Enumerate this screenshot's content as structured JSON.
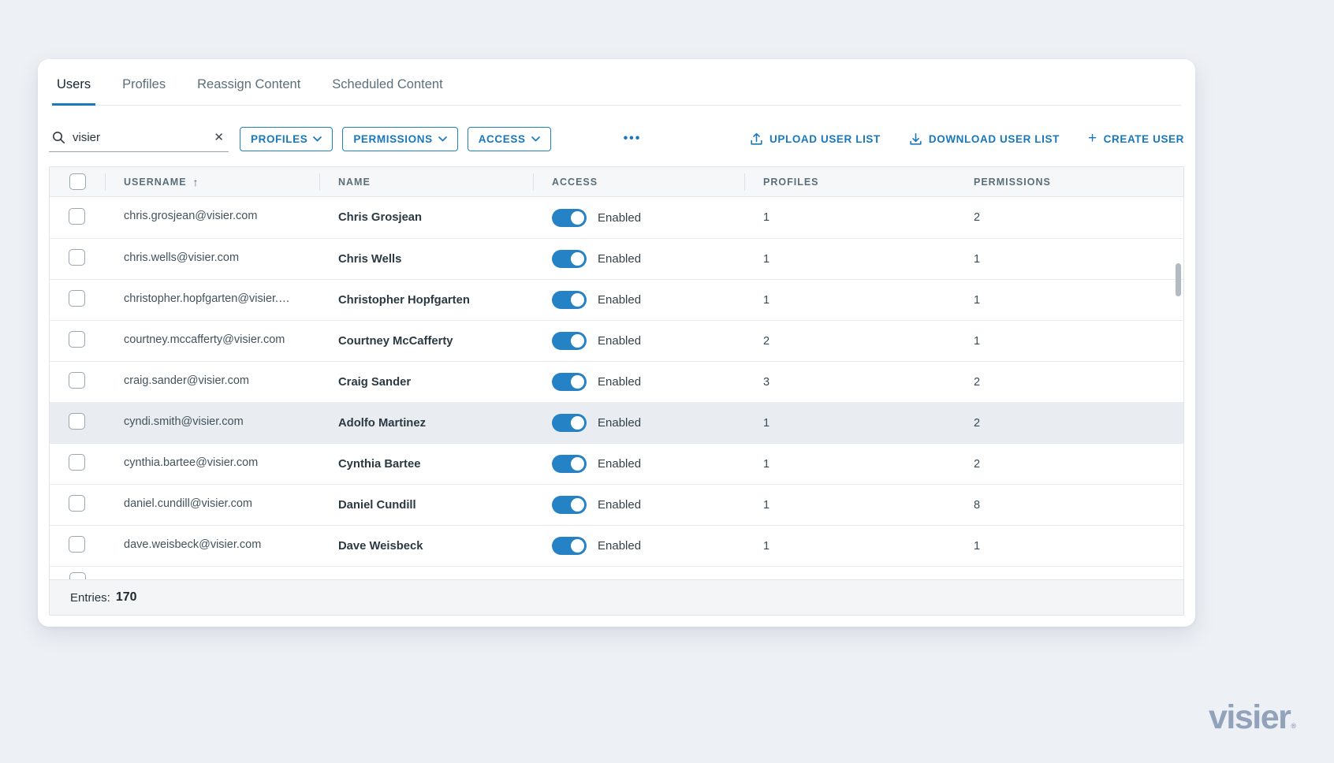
{
  "tabs": [
    {
      "label": "Users",
      "active": true
    },
    {
      "label": "Profiles",
      "active": false
    },
    {
      "label": "Reassign Content",
      "active": false
    },
    {
      "label": "Scheduled Content",
      "active": false
    }
  ],
  "toolbar": {
    "search": {
      "value": "visier",
      "placeholder": ""
    },
    "filters": [
      {
        "label": "PROFILES"
      },
      {
        "label": "PERMISSIONS"
      },
      {
        "label": "ACCESS"
      }
    ],
    "actions": [
      {
        "label": "UPLOAD USER LIST"
      },
      {
        "label": "DOWNLOAD USER LIST"
      },
      {
        "label": "CREATE USER"
      }
    ]
  },
  "table": {
    "columns": [
      "USERNAME",
      "NAME",
      "ACCESS",
      "PROFILES",
      "PERMISSIONS"
    ],
    "rows": [
      {
        "username": "chris.grosjean@visier.com",
        "name": "Chris Grosjean",
        "access": "Enabled",
        "profiles": "1",
        "permissions": "2",
        "highlighted": false
      },
      {
        "username": "chris.wells@visier.com",
        "name": "Chris Wells",
        "access": "Enabled",
        "profiles": "1",
        "permissions": "1",
        "highlighted": false
      },
      {
        "username": "christopher.hopfgarten@visier.…",
        "name": "Christopher Hopfgarten",
        "access": "Enabled",
        "profiles": "1",
        "permissions": "1",
        "highlighted": false
      },
      {
        "username": "courtney.mccafferty@visier.com",
        "name": "Courtney McCafferty",
        "access": "Enabled",
        "profiles": "2",
        "permissions": "1",
        "highlighted": false
      },
      {
        "username": "craig.sander@visier.com",
        "name": "Craig Sander",
        "access": "Enabled",
        "profiles": "3",
        "permissions": "2",
        "highlighted": false
      },
      {
        "username": "cyndi.smith@visier.com",
        "name": "Adolfo Martinez",
        "access": "Enabled",
        "profiles": "1",
        "permissions": "2",
        "highlighted": true
      },
      {
        "username": "cynthia.bartee@visier.com",
        "name": "Cynthia Bartee",
        "access": "Enabled",
        "profiles": "1",
        "permissions": "2",
        "highlighted": false
      },
      {
        "username": "daniel.cundill@visier.com",
        "name": "Daniel Cundill",
        "access": "Enabled",
        "profiles": "1",
        "permissions": "8",
        "highlighted": false
      },
      {
        "username": "dave.weisbeck@visier.com",
        "name": "Dave Weisbeck",
        "access": "Enabled",
        "profiles": "1",
        "permissions": "1",
        "highlighted": false
      }
    ]
  },
  "footer": {
    "entries_label": "Entries:",
    "entries_value": "170"
  },
  "logo": {
    "text": "visier",
    "mark": "®"
  },
  "icons": {
    "more": "•••",
    "sort_asc": "↑",
    "clear": "✕",
    "plus": "+"
  },
  "colors": {
    "accent": "#1879bd",
    "toggle_on": "#2583c5",
    "row_highlight": "#e9ecf1",
    "logo": "#93a2bb"
  }
}
